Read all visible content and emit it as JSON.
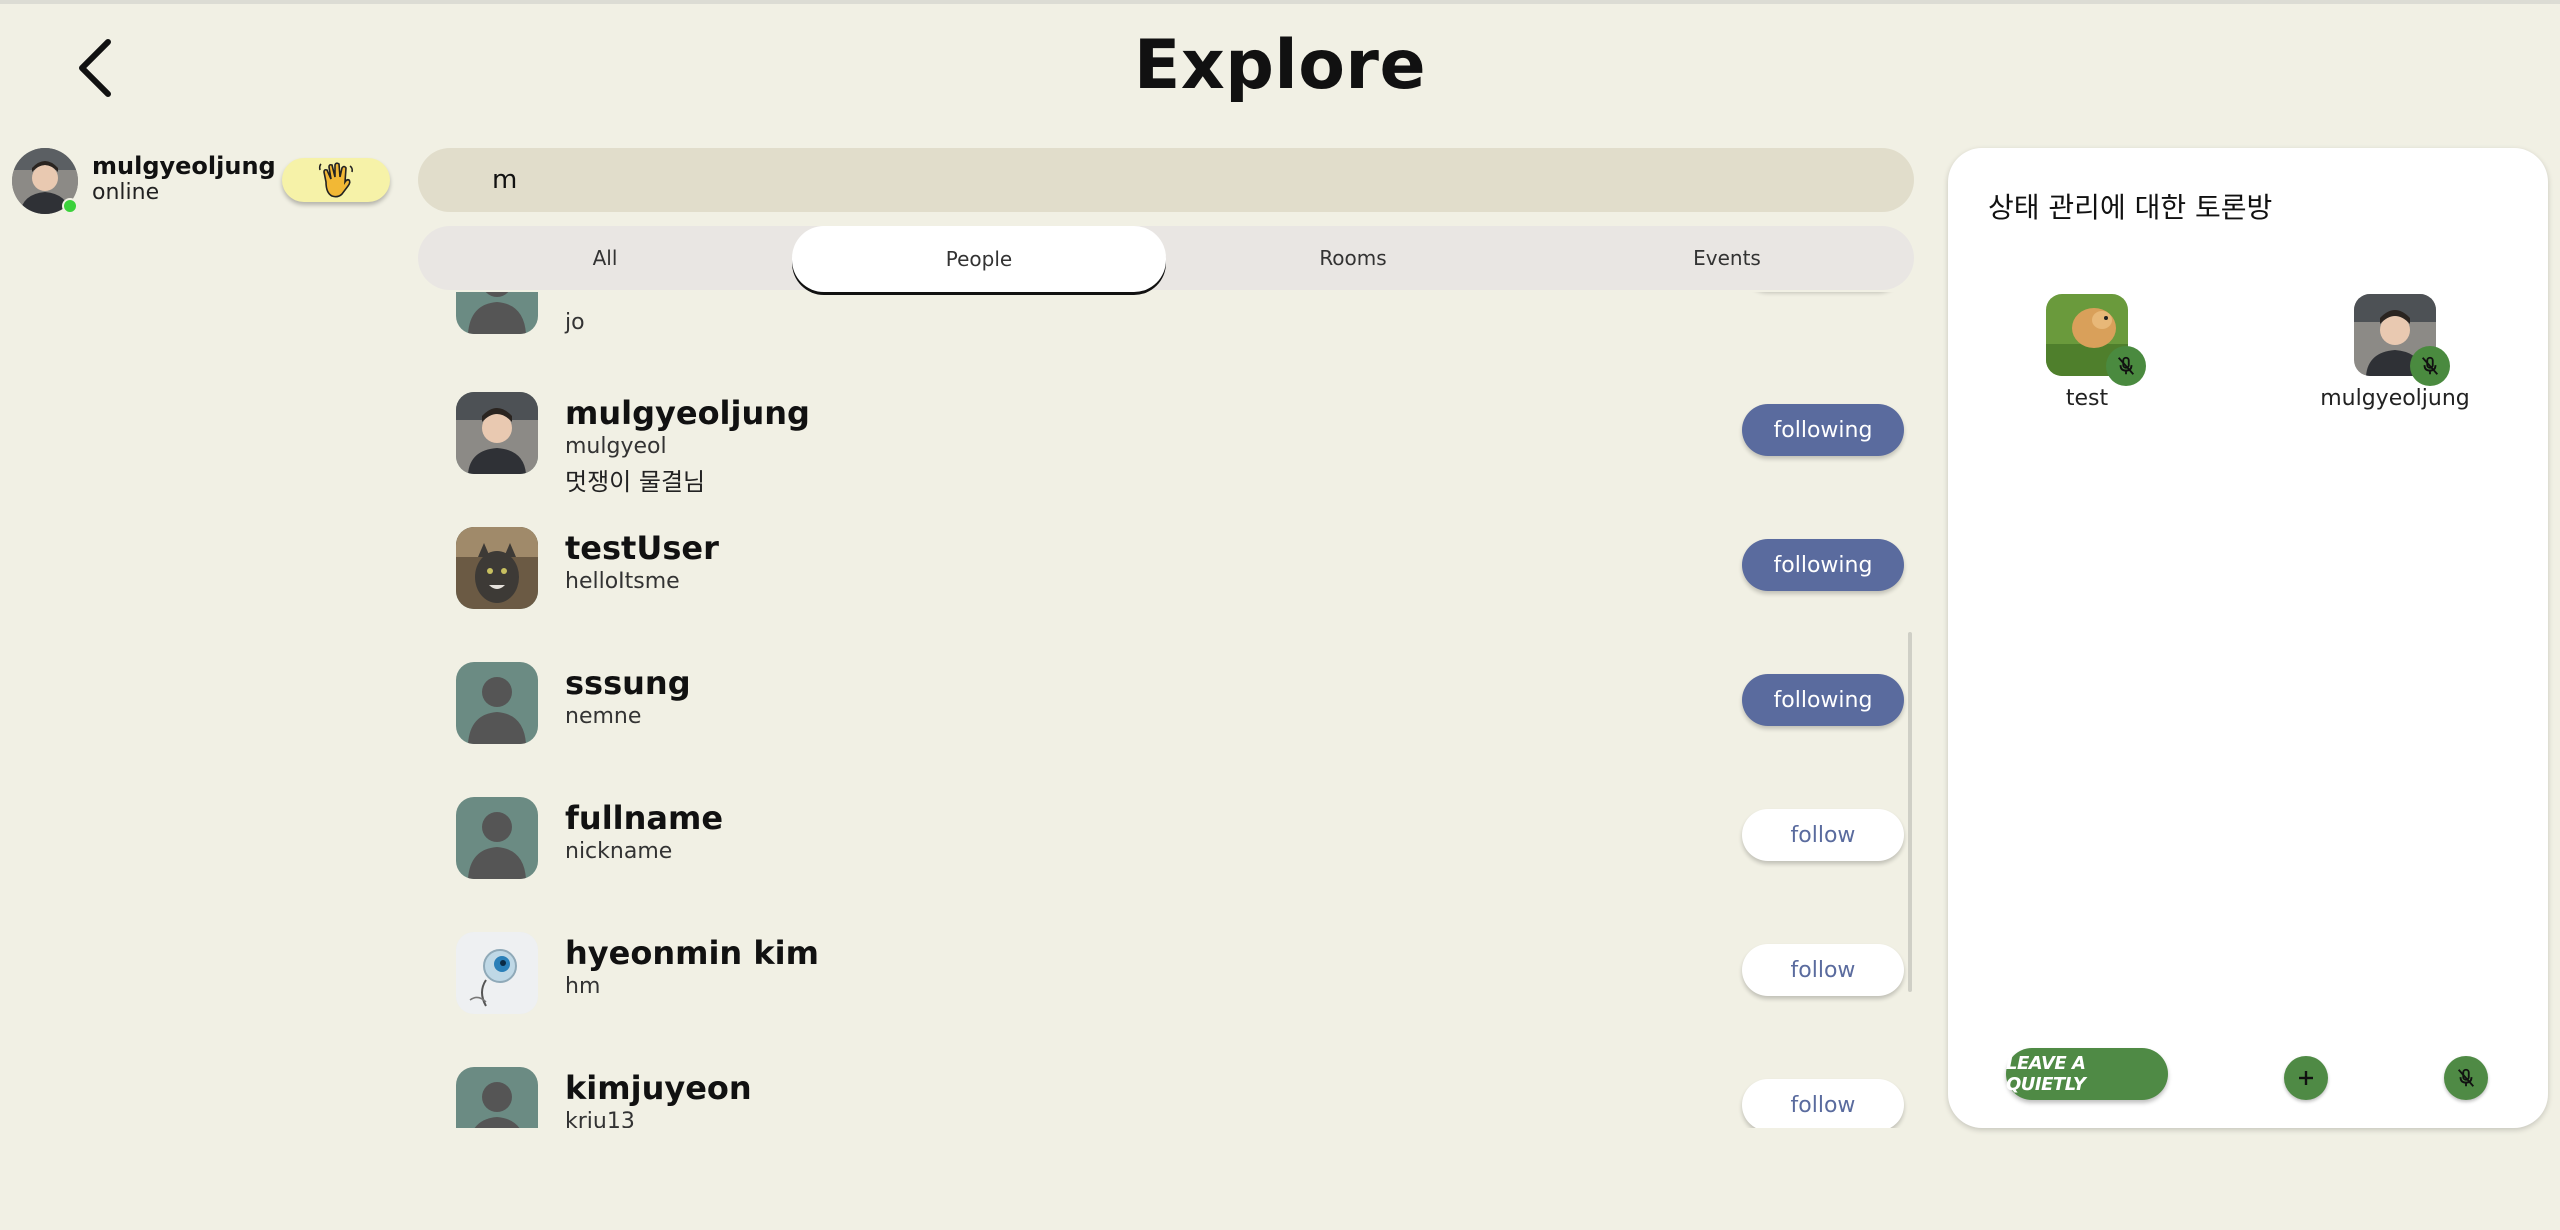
{
  "header": {
    "title": "Explore",
    "back_icon": "chevron-left-icon"
  },
  "current_user": {
    "name": "mulgyeoljung",
    "status": "online",
    "wave_icon": "waving-hand-icon"
  },
  "search": {
    "value": "m",
    "placeholder": ""
  },
  "tabs": [
    {
      "label": "All",
      "active": false
    },
    {
      "label": "People",
      "active": true
    },
    {
      "label": "Rooms",
      "active": false
    },
    {
      "label": "Events",
      "active": false
    }
  ],
  "people": [
    {
      "name": "",
      "nickname": "jo",
      "bio": "",
      "button": ""
    },
    {
      "name": "mulgyeoljung",
      "nickname": "mulgyeol",
      "bio": "멋쟁이 물결님",
      "button": "following"
    },
    {
      "name": "testUser",
      "nickname": "helloItsme",
      "bio": "",
      "button": "following"
    },
    {
      "name": "sssung",
      "nickname": "nemne",
      "bio": "",
      "button": "following"
    },
    {
      "name": "fullname",
      "nickname": "nickname",
      "bio": "",
      "button": "follow"
    },
    {
      "name": "hyeonmin kim",
      "nickname": "hm",
      "bio": "",
      "button": "follow"
    },
    {
      "name": "kimjuyeon",
      "nickname": "krju13",
      "bio": "",
      "button": "follow"
    }
  ],
  "room": {
    "title": "상태 관리에 대한 토론방",
    "speakers": [
      {
        "name": "test",
        "muted": true
      },
      {
        "name": "mulgyeoljung",
        "muted": true
      }
    ],
    "leave_label": "LEAVE A QUIETLY",
    "add_icon": "plus-icon",
    "mic_icon": "mic-off-icon"
  },
  "colors": {
    "background": "#f1f0e4",
    "following_button": "#5a6b9e",
    "room_green": "#4f8a45",
    "wave_button": "#f6f2a8",
    "online_dot": "#3bd13b"
  }
}
